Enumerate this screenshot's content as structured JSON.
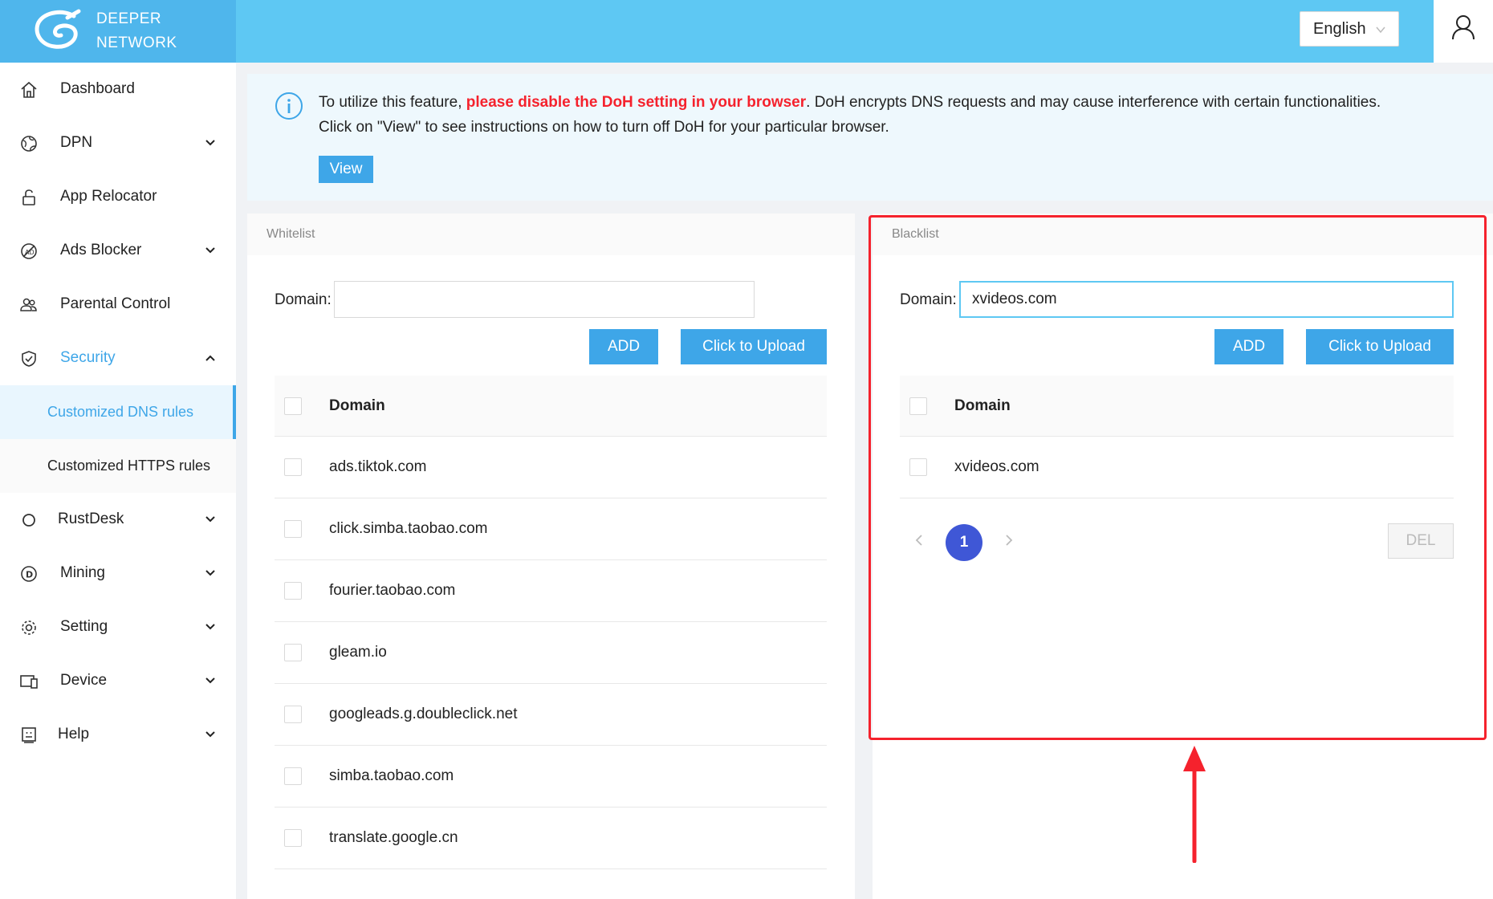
{
  "header": {
    "brand_line1": "DEEPER",
    "brand_line2": "NETWORK",
    "language": "English"
  },
  "sidebar": {
    "items": [
      {
        "label": "Dashboard",
        "icon": "home-icon"
      },
      {
        "label": "DPN",
        "icon": "globe-icon"
      },
      {
        "label": "App Relocator",
        "icon": "lock-icon"
      },
      {
        "label": "Ads Blocker",
        "icon": "ad-block-icon"
      },
      {
        "label": "Parental Control",
        "icon": "users-icon"
      },
      {
        "label": "Security",
        "icon": "shield-icon"
      },
      {
        "label": "RustDesk",
        "icon": "circle-icon"
      },
      {
        "label": "Mining",
        "icon": "coin-icon"
      },
      {
        "label": "Setting",
        "icon": "gear-icon"
      },
      {
        "label": "Device",
        "icon": "device-icon"
      },
      {
        "label": "Help",
        "icon": "help-icon"
      }
    ],
    "security_sub": [
      {
        "label": "Customized DNS rules"
      },
      {
        "label": "Customized HTTPS rules"
      }
    ]
  },
  "notice": {
    "prefix": "To utilize this feature, ",
    "highlight": "please disable the DoH setting in your browser",
    "suffix": ". DoH encrypts DNS requests and may cause interference with certain functionalities.",
    "line2": "Click on \"View\" to see instructions on how to turn off DoH for your particular browser.",
    "view_label": "View"
  },
  "whitelist": {
    "title": "Whitelist",
    "domain_label": "Domain:",
    "domain_value": "",
    "add_label": "ADD",
    "upload_label": "Click to Upload",
    "column_header": "Domain",
    "rows": [
      "ads.tiktok.com",
      "click.simba.taobao.com",
      "fourier.taobao.com",
      "gleam.io",
      "googleads.g.doubleclick.net",
      "simba.taobao.com",
      "translate.google.cn"
    ]
  },
  "blacklist": {
    "title": "Blacklist",
    "domain_label": "Domain:",
    "domain_value": "xvideos.com",
    "add_label": "ADD",
    "upload_label": "Click to Upload",
    "column_header": "Domain",
    "rows": [
      "xvideos.com"
    ],
    "page": "1",
    "del_label": "DEL"
  },
  "colors": {
    "header": "#5ec8f3",
    "accent": "#3ea6e8",
    "highlight_red": "#f5222d",
    "pager_active": "#3f57d6"
  }
}
